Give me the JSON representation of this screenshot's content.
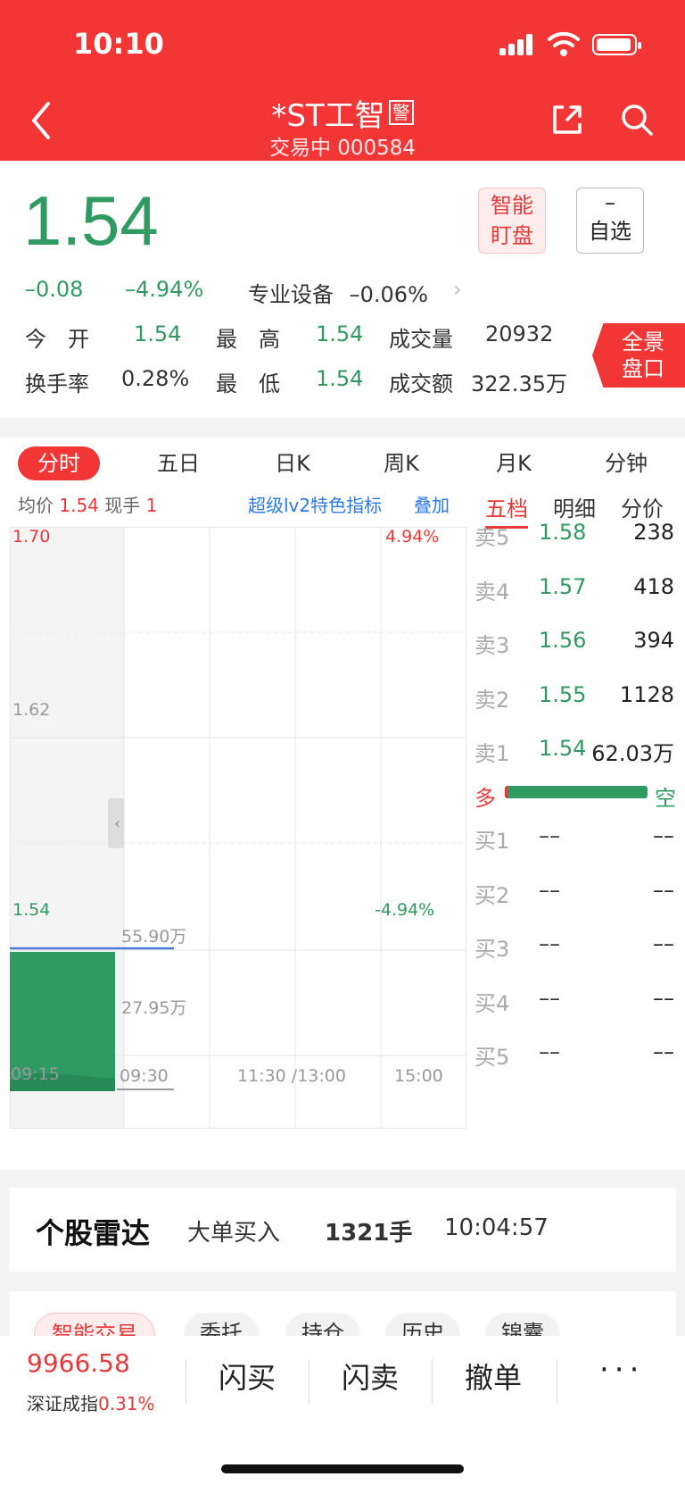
{
  "status_bar": {
    "time": "10:10"
  },
  "header": {
    "title": "*ST工智",
    "badge": "警",
    "status": "交易中",
    "code": "000584"
  },
  "quote": {
    "price": "1.54",
    "change": "–0.08",
    "change_pct": "–4.94%",
    "sector_name": "专业设备",
    "sector_pct": "–0.06%",
    "smart_btn": [
      "智能",
      "盯盘"
    ],
    "fav_btn": [
      "–",
      "自选"
    ],
    "panorama_btn": [
      "全景",
      "盘口"
    ],
    "open_label": "今　开",
    "open": "1.54",
    "high_label": "最　高",
    "high": "1.54",
    "volume_label": "成交量",
    "volume": "20932",
    "turnover_label": "换手率",
    "turnover": "0.28%",
    "low_label": "最　低",
    "low": "1.54",
    "amount_label": "成交额",
    "amount": "322.35万"
  },
  "tabs": [
    "分时",
    "五日",
    "日K",
    "周K",
    "月K",
    "分钟"
  ],
  "subbar": {
    "avg_label": "均价",
    "avg": "1.54",
    "hand_label": "现手",
    "hand": "1",
    "lv2": "超级lv2特色指标",
    "overlay": "叠加"
  },
  "orderbook_tabs": [
    "五档",
    "明细",
    "分价"
  ],
  "chart_axis": {
    "y_top": "1.70",
    "y_mid": "1.62",
    "y_bot": "1.54",
    "pct_top": "4.94%",
    "pct_bot": "-4.94%",
    "vol_top": "55.90万",
    "vol_mid": "27.95万",
    "x_labels": [
      "09:15",
      "09:30",
      "11:30 /13:00",
      "15:00"
    ]
  },
  "chart_data": {
    "type": "area",
    "x": [
      "09:15",
      "09:30"
    ],
    "price_series": {
      "values": [
        1.54,
        1.54
      ]
    },
    "volume_max_label": "55.90万",
    "ylim": [
      1.54,
      1.7
    ],
    "grid": true
  },
  "asks": [
    {
      "name": "卖5",
      "price": "1.58",
      "vol": "238"
    },
    {
      "name": "卖4",
      "price": "1.57",
      "vol": "418"
    },
    {
      "name": "卖3",
      "price": "1.56",
      "vol": "394"
    },
    {
      "name": "卖2",
      "price": "1.55",
      "vol": "1128"
    },
    {
      "name": "卖1",
      "price": "1.54",
      "vol": "62.03万"
    }
  ],
  "ratio": {
    "left": "多",
    "right": "空",
    "long_fraction": 0.02
  },
  "bids": [
    {
      "name": "买1",
      "price": "––",
      "vol": "––"
    },
    {
      "name": "买2",
      "price": "––",
      "vol": "––"
    },
    {
      "name": "买3",
      "price": "––",
      "vol": "––"
    },
    {
      "name": "买4",
      "price": "––",
      "vol": "––"
    },
    {
      "name": "买5",
      "price": "––",
      "vol": "––"
    }
  ],
  "radar": {
    "title": "个股雷达",
    "event": "大单买入",
    "qty": "1321手",
    "time": "10:04:57"
  },
  "chips": [
    "智能交易",
    "委托",
    "持仓",
    "历史",
    "锦囊"
  ],
  "bottom": {
    "index_value": "9966.58",
    "index_name": "深证成指",
    "index_pct": "0.31%",
    "actions": [
      "闪买",
      "闪卖",
      "撤单"
    ]
  }
}
